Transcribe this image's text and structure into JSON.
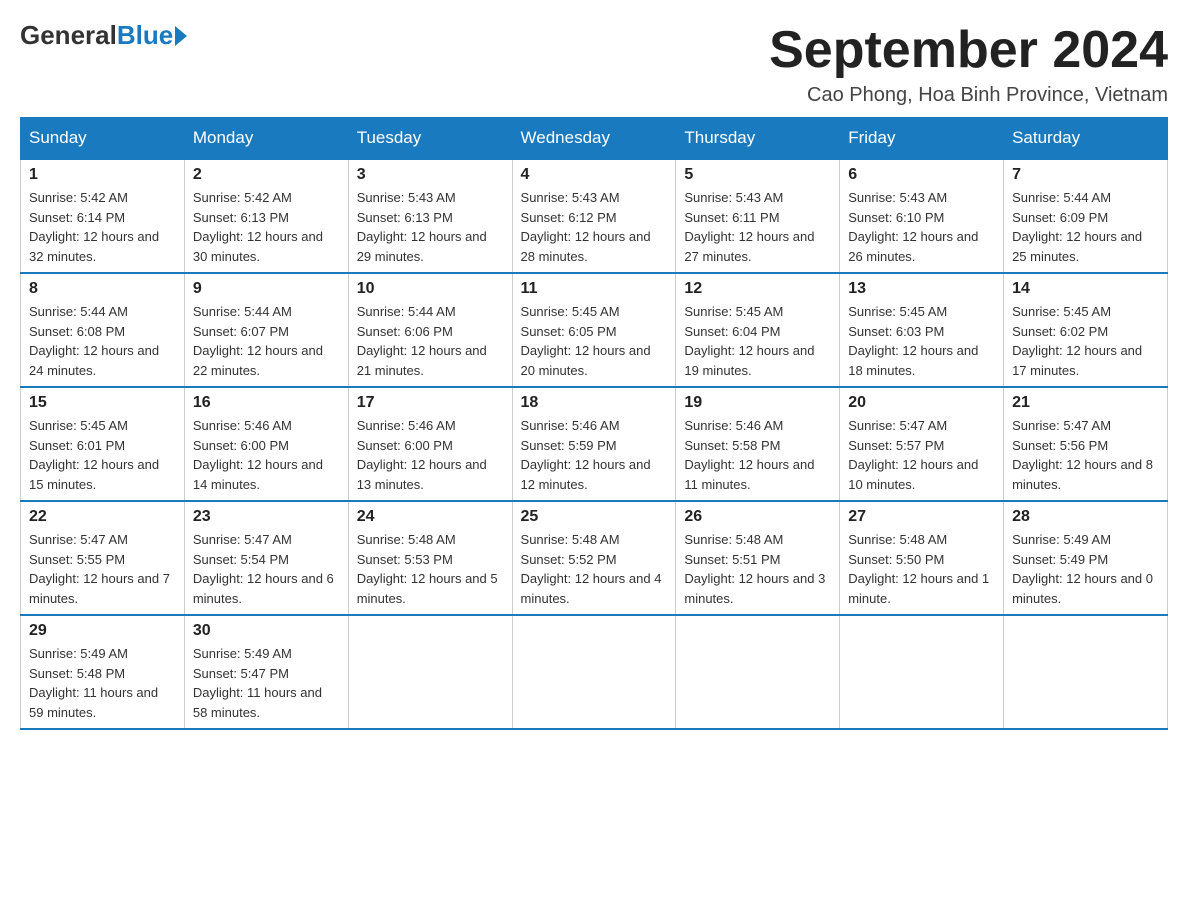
{
  "logo": {
    "general": "General",
    "blue": "Blue"
  },
  "title": {
    "month_year": "September 2024",
    "location": "Cao Phong, Hoa Binh Province, Vietnam"
  },
  "days_of_week": [
    "Sunday",
    "Monday",
    "Tuesday",
    "Wednesday",
    "Thursday",
    "Friday",
    "Saturday"
  ],
  "weeks": [
    [
      {
        "day": "1",
        "sunrise": "Sunrise: 5:42 AM",
        "sunset": "Sunset: 6:14 PM",
        "daylight": "Daylight: 12 hours and 32 minutes."
      },
      {
        "day": "2",
        "sunrise": "Sunrise: 5:42 AM",
        "sunset": "Sunset: 6:13 PM",
        "daylight": "Daylight: 12 hours and 30 minutes."
      },
      {
        "day": "3",
        "sunrise": "Sunrise: 5:43 AM",
        "sunset": "Sunset: 6:13 PM",
        "daylight": "Daylight: 12 hours and 29 minutes."
      },
      {
        "day": "4",
        "sunrise": "Sunrise: 5:43 AM",
        "sunset": "Sunset: 6:12 PM",
        "daylight": "Daylight: 12 hours and 28 minutes."
      },
      {
        "day": "5",
        "sunrise": "Sunrise: 5:43 AM",
        "sunset": "Sunset: 6:11 PM",
        "daylight": "Daylight: 12 hours and 27 minutes."
      },
      {
        "day": "6",
        "sunrise": "Sunrise: 5:43 AM",
        "sunset": "Sunset: 6:10 PM",
        "daylight": "Daylight: 12 hours and 26 minutes."
      },
      {
        "day": "7",
        "sunrise": "Sunrise: 5:44 AM",
        "sunset": "Sunset: 6:09 PM",
        "daylight": "Daylight: 12 hours and 25 minutes."
      }
    ],
    [
      {
        "day": "8",
        "sunrise": "Sunrise: 5:44 AM",
        "sunset": "Sunset: 6:08 PM",
        "daylight": "Daylight: 12 hours and 24 minutes."
      },
      {
        "day": "9",
        "sunrise": "Sunrise: 5:44 AM",
        "sunset": "Sunset: 6:07 PM",
        "daylight": "Daylight: 12 hours and 22 minutes."
      },
      {
        "day": "10",
        "sunrise": "Sunrise: 5:44 AM",
        "sunset": "Sunset: 6:06 PM",
        "daylight": "Daylight: 12 hours and 21 minutes."
      },
      {
        "day": "11",
        "sunrise": "Sunrise: 5:45 AM",
        "sunset": "Sunset: 6:05 PM",
        "daylight": "Daylight: 12 hours and 20 minutes."
      },
      {
        "day": "12",
        "sunrise": "Sunrise: 5:45 AM",
        "sunset": "Sunset: 6:04 PM",
        "daylight": "Daylight: 12 hours and 19 minutes."
      },
      {
        "day": "13",
        "sunrise": "Sunrise: 5:45 AM",
        "sunset": "Sunset: 6:03 PM",
        "daylight": "Daylight: 12 hours and 18 minutes."
      },
      {
        "day": "14",
        "sunrise": "Sunrise: 5:45 AM",
        "sunset": "Sunset: 6:02 PM",
        "daylight": "Daylight: 12 hours and 17 minutes."
      }
    ],
    [
      {
        "day": "15",
        "sunrise": "Sunrise: 5:45 AM",
        "sunset": "Sunset: 6:01 PM",
        "daylight": "Daylight: 12 hours and 15 minutes."
      },
      {
        "day": "16",
        "sunrise": "Sunrise: 5:46 AM",
        "sunset": "Sunset: 6:00 PM",
        "daylight": "Daylight: 12 hours and 14 minutes."
      },
      {
        "day": "17",
        "sunrise": "Sunrise: 5:46 AM",
        "sunset": "Sunset: 6:00 PM",
        "daylight": "Daylight: 12 hours and 13 minutes."
      },
      {
        "day": "18",
        "sunrise": "Sunrise: 5:46 AM",
        "sunset": "Sunset: 5:59 PM",
        "daylight": "Daylight: 12 hours and 12 minutes."
      },
      {
        "day": "19",
        "sunrise": "Sunrise: 5:46 AM",
        "sunset": "Sunset: 5:58 PM",
        "daylight": "Daylight: 12 hours and 11 minutes."
      },
      {
        "day": "20",
        "sunrise": "Sunrise: 5:47 AM",
        "sunset": "Sunset: 5:57 PM",
        "daylight": "Daylight: 12 hours and 10 minutes."
      },
      {
        "day": "21",
        "sunrise": "Sunrise: 5:47 AM",
        "sunset": "Sunset: 5:56 PM",
        "daylight": "Daylight: 12 hours and 8 minutes."
      }
    ],
    [
      {
        "day": "22",
        "sunrise": "Sunrise: 5:47 AM",
        "sunset": "Sunset: 5:55 PM",
        "daylight": "Daylight: 12 hours and 7 minutes."
      },
      {
        "day": "23",
        "sunrise": "Sunrise: 5:47 AM",
        "sunset": "Sunset: 5:54 PM",
        "daylight": "Daylight: 12 hours and 6 minutes."
      },
      {
        "day": "24",
        "sunrise": "Sunrise: 5:48 AM",
        "sunset": "Sunset: 5:53 PM",
        "daylight": "Daylight: 12 hours and 5 minutes."
      },
      {
        "day": "25",
        "sunrise": "Sunrise: 5:48 AM",
        "sunset": "Sunset: 5:52 PM",
        "daylight": "Daylight: 12 hours and 4 minutes."
      },
      {
        "day": "26",
        "sunrise": "Sunrise: 5:48 AM",
        "sunset": "Sunset: 5:51 PM",
        "daylight": "Daylight: 12 hours and 3 minutes."
      },
      {
        "day": "27",
        "sunrise": "Sunrise: 5:48 AM",
        "sunset": "Sunset: 5:50 PM",
        "daylight": "Daylight: 12 hours and 1 minute."
      },
      {
        "day": "28",
        "sunrise": "Sunrise: 5:49 AM",
        "sunset": "Sunset: 5:49 PM",
        "daylight": "Daylight: 12 hours and 0 minutes."
      }
    ],
    [
      {
        "day": "29",
        "sunrise": "Sunrise: 5:49 AM",
        "sunset": "Sunset: 5:48 PM",
        "daylight": "Daylight: 11 hours and 59 minutes."
      },
      {
        "day": "30",
        "sunrise": "Sunrise: 5:49 AM",
        "sunset": "Sunset: 5:47 PM",
        "daylight": "Daylight: 11 hours and 58 minutes."
      },
      null,
      null,
      null,
      null,
      null
    ]
  ]
}
